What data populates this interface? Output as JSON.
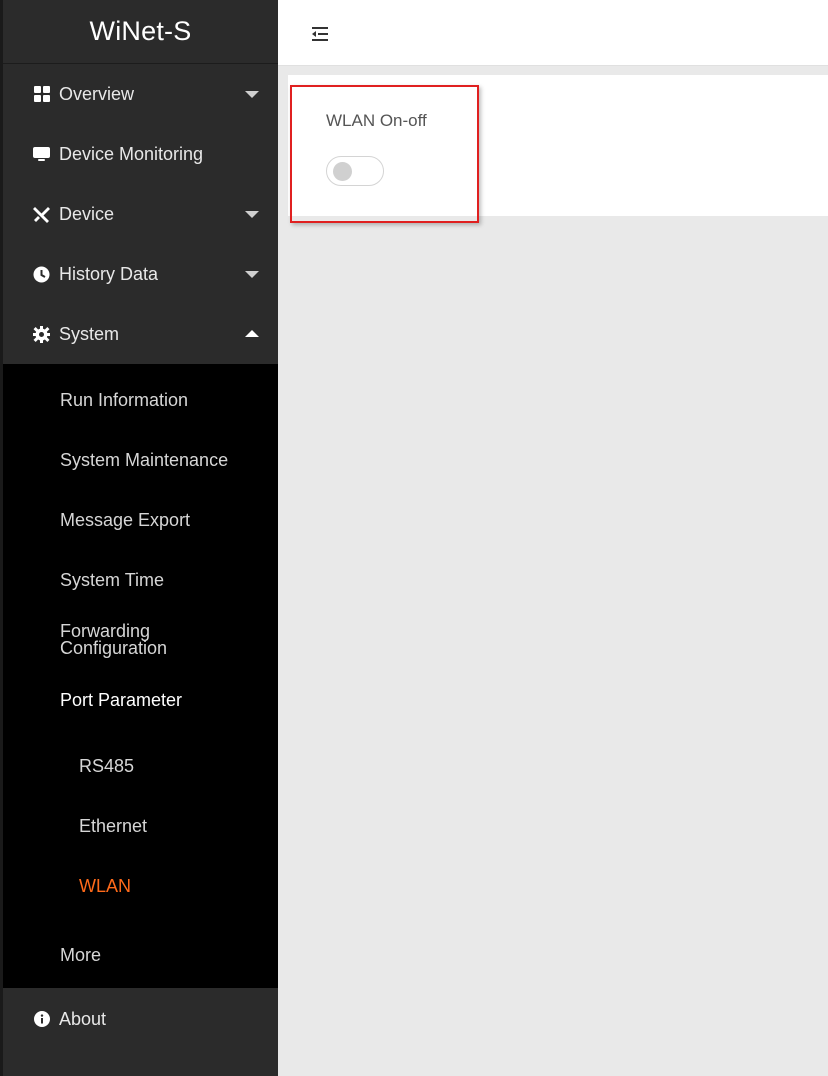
{
  "brand": "WiNet-S",
  "sidebar": {
    "items": [
      {
        "label": "Overview",
        "icon": "grid-icon"
      },
      {
        "label": "Device Monitoring",
        "icon": "monitor-icon"
      },
      {
        "label": "Device",
        "icon": "tools-icon"
      },
      {
        "label": "History Data",
        "icon": "clock-icon"
      },
      {
        "label": "System",
        "icon": "gear-icon"
      }
    ],
    "system_submenu": [
      {
        "label": "Run Information"
      },
      {
        "label": "System Maintenance"
      },
      {
        "label": "Message Export"
      },
      {
        "label": "System Time"
      },
      {
        "label_line1": "Forwarding",
        "label_line2": "Configuration"
      },
      {
        "label": "Port Parameter"
      }
    ],
    "port_parameter_submenu": [
      {
        "label": "RS485"
      },
      {
        "label": "Ethernet"
      },
      {
        "label": "WLAN"
      }
    ],
    "more": "More",
    "about": "About"
  },
  "main": {
    "wlan_label": "WLAN On-off",
    "wlan_enabled": false
  },
  "colors": {
    "sidebar_bg": "#2b2b2b",
    "submenu_bg": "#000000",
    "accent": "#ff6a1a",
    "highlight_border": "#e02020"
  }
}
